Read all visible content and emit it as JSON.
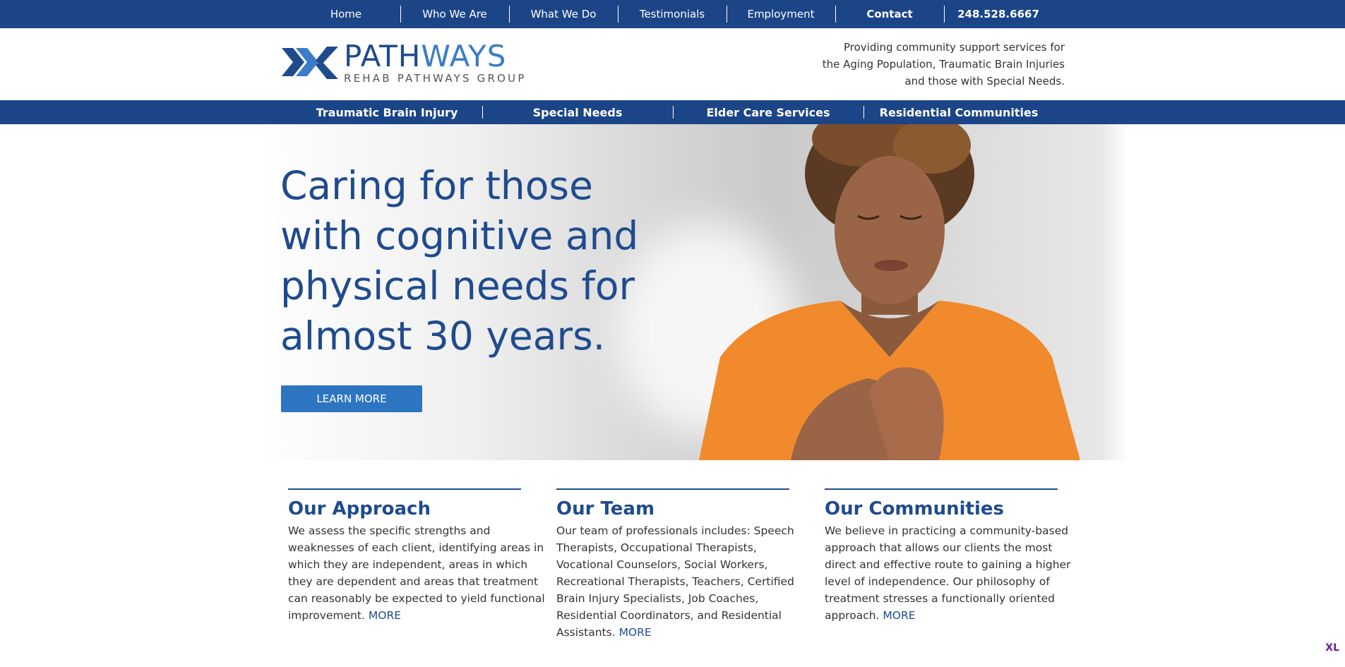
{
  "topnav": {
    "items": [
      {
        "label": "Home",
        "bold": false
      },
      {
        "label": "Who We Are",
        "bold": false
      },
      {
        "label": "What We Do",
        "bold": false
      },
      {
        "label": "Testimonials",
        "bold": false
      },
      {
        "label": "Employment",
        "bold": false
      },
      {
        "label": "Contact",
        "bold": true
      },
      {
        "label": "248.528.6667",
        "bold": true
      }
    ]
  },
  "header": {
    "logo_word_dark": "PATH",
    "logo_word_light": "WAYS",
    "logo_sub": "REHAB PATHWAYS GROUP",
    "tagline": [
      "Providing community support services for",
      "the Aging Population, Traumatic Brain Injuries",
      "and those with Special Needs."
    ]
  },
  "subnav": {
    "items": [
      {
        "label": "Traumatic Brain Injury"
      },
      {
        "label": "Special Needs"
      },
      {
        "label": "Elder Care Services"
      },
      {
        "label": "Residential Communities"
      }
    ]
  },
  "hero": {
    "headline_lines": [
      "Caring for those",
      "with cognitive and",
      "physical needs for",
      "almost 30 years."
    ],
    "cta_label": "LEARN MORE"
  },
  "columns": [
    {
      "title": "Our Approach",
      "lines": [
        "We assess the specific strengths and",
        "weaknesses of each client, identifying areas in",
        "which they are independent, areas in which",
        "they are dependent and areas that treatment",
        "can reasonably be expected to yield functional",
        "improvement."
      ],
      "more": "MORE"
    },
    {
      "title": "Our Team",
      "lines": [
        "Our team of professionals includes: Speech",
        "Therapists, Occupational Therapists,",
        "Vocational Counselors, Social Workers,",
        "Recreational Therapists, Teachers, Certified",
        "Brain Injury Specialists, Job Coaches,",
        "Residential Coordinators, and Residential",
        "Assistants."
      ],
      "more": "MORE"
    },
    {
      "title": "Our Communities",
      "lines": [
        "We believe in practicing a community-based",
        "approach that allows our clients the most",
        "direct and effective route to gaining a higher",
        "level of independence. Our philosophy of",
        "treatment stresses a functionally oriented",
        "approach."
      ],
      "more": "MORE"
    }
  ],
  "badge": "XL",
  "colors": {
    "brand_navy": "#1c4587",
    "brand_blue": "#2e75c1",
    "sweater_orange": "#f08a2c"
  }
}
